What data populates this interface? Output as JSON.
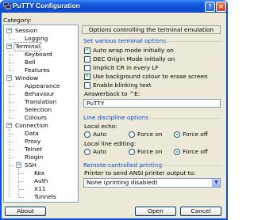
{
  "window": {
    "title": "PuTTY Configuration"
  },
  "category_label": "Category:",
  "tree": [
    {
      "label": "Session",
      "level": 0,
      "expander": "−"
    },
    {
      "label": "Logging",
      "level": 1
    },
    {
      "label": "Terminal",
      "level": 0,
      "expander": "−",
      "selected": true
    },
    {
      "label": "Keyboard",
      "level": 1
    },
    {
      "label": "Bell",
      "level": 1
    },
    {
      "label": "Features",
      "level": 1
    },
    {
      "label": "Window",
      "level": 0,
      "expander": "−"
    },
    {
      "label": "Appearance",
      "level": 1
    },
    {
      "label": "Behaviour",
      "level": 1
    },
    {
      "label": "Translation",
      "level": 1
    },
    {
      "label": "Selection",
      "level": 1
    },
    {
      "label": "Colours",
      "level": 1
    },
    {
      "label": "Connection",
      "level": 0,
      "expander": "−"
    },
    {
      "label": "Data",
      "level": 1
    },
    {
      "label": "Proxy",
      "level": 1
    },
    {
      "label": "Telnet",
      "level": 1
    },
    {
      "label": "Rlogin",
      "level": 1
    },
    {
      "label": "SSH",
      "level": 1,
      "expander": "−"
    },
    {
      "label": "Kex",
      "level": 2
    },
    {
      "label": "Auth",
      "level": 2
    },
    {
      "label": "X11",
      "level": 2
    },
    {
      "label": "Tunnels",
      "level": 2
    }
  ],
  "panel_header": "Options controlling the terminal emulation",
  "terminal_options": {
    "title": "Set various terminal options",
    "items": [
      {
        "label": "Auto wrap mode initially on",
        "checked": true
      },
      {
        "label": "DEC Origin Mode initially on",
        "checked": false
      },
      {
        "label": "Implicit CR in every LF",
        "checked": false
      },
      {
        "label": "Use background colour to erase screen",
        "checked": true
      },
      {
        "label": "Enable blinking text",
        "checked": false
      }
    ],
    "answerback_label": "Answerback to ^E:",
    "answerback_value": "PuTTY"
  },
  "line_discipline": {
    "title": "Line discipline options",
    "local_echo_label": "Local echo:",
    "local_editing_label": "Local line editing:",
    "options": [
      "Auto",
      "Force on",
      "Force off"
    ],
    "local_echo_selected": "Force off",
    "local_editing_selected": "Force off"
  },
  "printing": {
    "title": "Remote-controlled printing",
    "printer_label": "Printer to send ANSI printer output to:",
    "printer_value": "None (printing disabled)"
  },
  "buttons": {
    "about": "About",
    "open": "Open",
    "cancel": "Cancel"
  },
  "colors": {
    "titlebar": "#0b4bd0",
    "section_title": "#0046d5",
    "dialog_bg": "#ece9d8",
    "check_mark": "#21a121"
  }
}
